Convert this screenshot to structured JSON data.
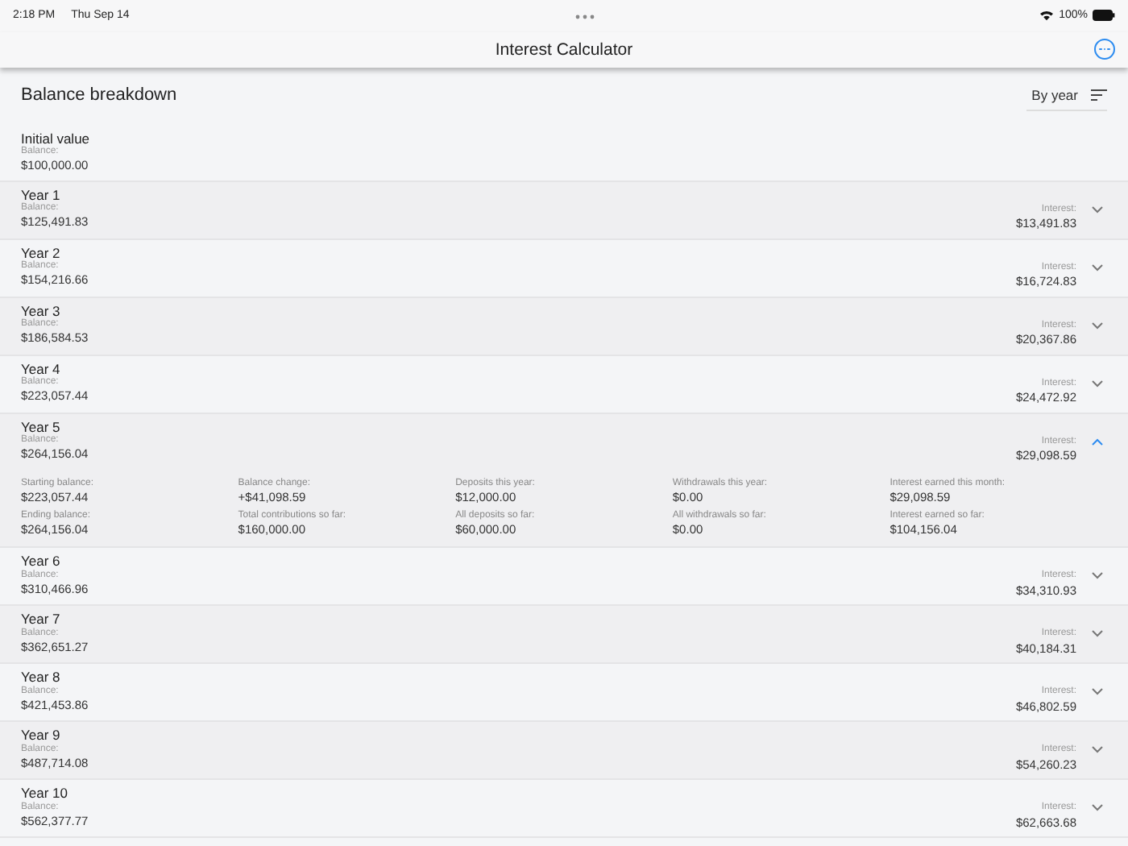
{
  "status_bar": {
    "time": "2:18 PM",
    "date": "Thu Sep 14",
    "battery": "100%"
  },
  "nav": {
    "title": "Interest Calculator"
  },
  "section": {
    "title": "Balance breakdown",
    "sort_label": "By year"
  },
  "initial": {
    "title": "Initial value",
    "balance_label": "Balance:",
    "balance": "$100,000.00"
  },
  "years": [
    {
      "title": "Year 1",
      "balance_label": "Balance:",
      "balance": "$125,491.83",
      "interest_label": "Interest:",
      "interest": "$13,491.83",
      "expanded": false
    },
    {
      "title": "Year 2",
      "balance_label": "Balance:",
      "balance": "$154,216.66",
      "interest_label": "Interest:",
      "interest": "$16,724.83",
      "expanded": false
    },
    {
      "title": "Year 3",
      "balance_label": "Balance:",
      "balance": "$186,584.53",
      "interest_label": "Interest:",
      "interest": "$20,367.86",
      "expanded": false
    },
    {
      "title": "Year 4",
      "balance_label": "Balance:",
      "balance": "$223,057.44",
      "interest_label": "Interest:",
      "interest": "$24,472.92",
      "expanded": false
    },
    {
      "title": "Year 5",
      "balance_label": "Balance:",
      "balance": "$264,156.04",
      "interest_label": "Interest:",
      "interest": "$29,098.59",
      "expanded": true,
      "details": [
        {
          "label": "Starting balance:",
          "value": "$223,057.44"
        },
        {
          "label": "Balance change:",
          "value": "+$41,098.59"
        },
        {
          "label": "Deposits this year:",
          "value": "$12,000.00"
        },
        {
          "label": "Withdrawals this year:",
          "value": "$0.00"
        },
        {
          "label": "Interest earned this month:",
          "value": "$29,098.59"
        },
        {
          "label": "Ending balance:",
          "value": "$264,156.04"
        },
        {
          "label": "Total contributions so far:",
          "value": "$160,000.00"
        },
        {
          "label": "All deposits so far:",
          "value": "$60,000.00"
        },
        {
          "label": "All withdrawals so far:",
          "value": "$0.00"
        },
        {
          "label": "Interest earned so far:",
          "value": "$104,156.04"
        }
      ]
    },
    {
      "title": "Year 6",
      "balance_label": "Balance:",
      "balance": "$310,466.96",
      "interest_label": "Interest:",
      "interest": "$34,310.93",
      "expanded": false
    },
    {
      "title": "Year 7",
      "balance_label": "Balance:",
      "balance": "$362,651.27",
      "interest_label": "Interest:",
      "interest": "$40,184.31",
      "expanded": false
    },
    {
      "title": "Year 8",
      "balance_label": "Balance:",
      "balance": "$421,453.86",
      "interest_label": "Interest:",
      "interest": "$46,802.59",
      "expanded": false
    },
    {
      "title": "Year 9",
      "balance_label": "Balance:",
      "balance": "$487,714.08",
      "interest_label": "Interest:",
      "interest": "$54,260.23",
      "expanded": false
    },
    {
      "title": "Year 10",
      "balance_label": "Balance:",
      "balance": "$562,377.77",
      "interest_label": "Interest:",
      "interest": "$62,663.68",
      "expanded": false
    }
  ]
}
